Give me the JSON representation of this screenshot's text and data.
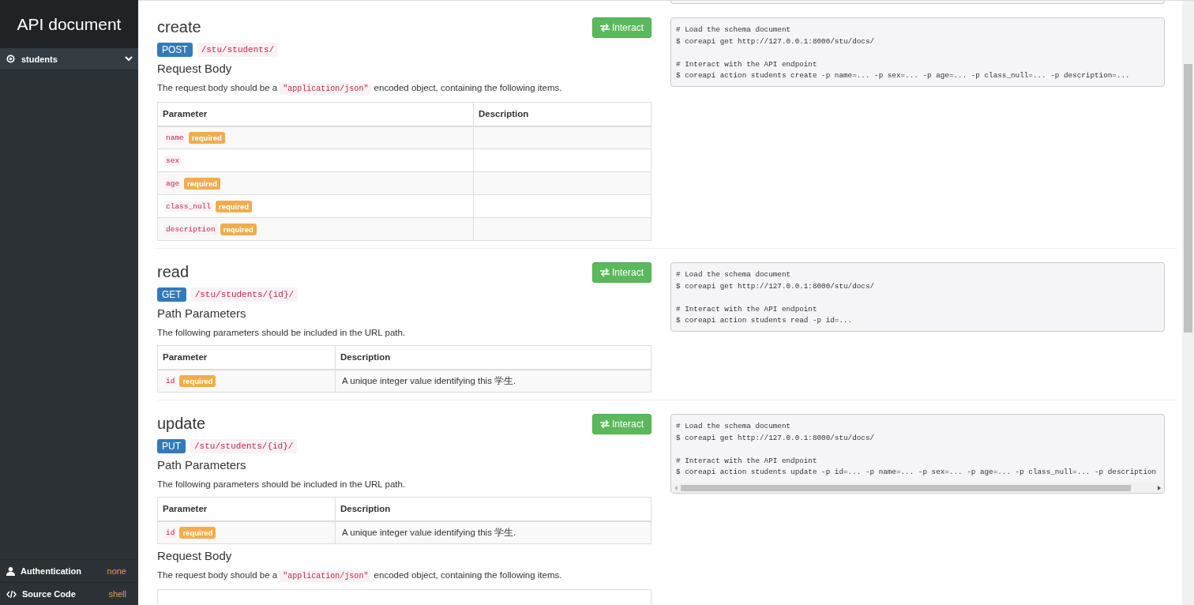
{
  "sidebar": {
    "title": "API document",
    "menu": [
      {
        "label": "students"
      }
    ],
    "footer": [
      {
        "kind": "auth",
        "label": "Authentication",
        "value": "none"
      },
      {
        "kind": "source",
        "label": "Source Code",
        "value": "shell"
      }
    ]
  },
  "endpoints": [
    {
      "title": "create",
      "method": "POST",
      "path": "/stu/students/",
      "button": "Interact",
      "sections": [
        {
          "kind": "body",
          "heading": "Request Body",
          "text_before": "The request body should be a ",
          "code": "\"application/json\"",
          "text_after": " encoded object, containing the following items.",
          "columns": [
            "Parameter",
            "Description"
          ],
          "rows": [
            {
              "name": "name",
              "badge": "required"
            },
            {
              "name": "sex"
            },
            {
              "name": "age",
              "badge": "required"
            },
            {
              "name": "class_null",
              "badge": "required"
            },
            {
              "name": "description",
              "badge": "required"
            }
          ]
        }
      ],
      "snippet": {
        "groups": [
          {
            "comment": "# Load the schema document",
            "command": "$ coreapi get http://127.0.0.1:8000/stu/docs/"
          },
          {
            "comment": "# Interact with the API endpoint",
            "command": "$ coreapi action students create -p name=... -p sex=... -p age=... -p class_null=... -p description=..."
          }
        ]
      }
    },
    {
      "title": "read",
      "method": "GET",
      "path": "/stu/students/{id}/",
      "button": "Interact",
      "sections": [
        {
          "kind": "path",
          "heading": "Path Parameters",
          "text_before": "The following parameters should be included in the URL path.",
          "columns": [
            "Parameter",
            "Description"
          ],
          "rows": [
            {
              "name": "id",
              "badge": "required",
              "description": "A unique integer value identifying this 学生."
            }
          ]
        }
      ],
      "snippet": {
        "groups": [
          {
            "comment": "# Load the schema document",
            "command": "$ coreapi get http://127.0.0.1:8000/stu/docs/"
          },
          {
            "comment": "# Interact with the API endpoint",
            "command": "$ coreapi action students read -p id=..."
          }
        ]
      }
    },
    {
      "title": "update",
      "method": "PUT",
      "path": "/stu/students/{id}/",
      "button": "Interact",
      "sections": [
        {
          "kind": "path",
          "heading": "Path Parameters",
          "text_before": "The following parameters should be included in the URL path.",
          "columns": [
            "Parameter",
            "Description"
          ],
          "rows": [
            {
              "name": "id",
              "badge": "required",
              "description": "A unique integer value identifying this 学生."
            }
          ]
        },
        {
          "kind": "body",
          "heading": "Request Body",
          "text_before": "The request body should be a ",
          "code": "\"application/json\"",
          "text_after": " encoded object, containing the following items."
        }
      ],
      "snippet": {
        "scrollable": true,
        "groups": [
          {
            "comment": "# Load the schema document",
            "command": "$ coreapi get http://127.0.0.1:8000/stu/docs/"
          },
          {
            "comment": "# Interact with the API endpoint",
            "command": "$ coreapi action students update -p id=... -p name=... -p sex=... -p age=... -p class_null=... -p description"
          }
        ]
      }
    }
  ]
}
